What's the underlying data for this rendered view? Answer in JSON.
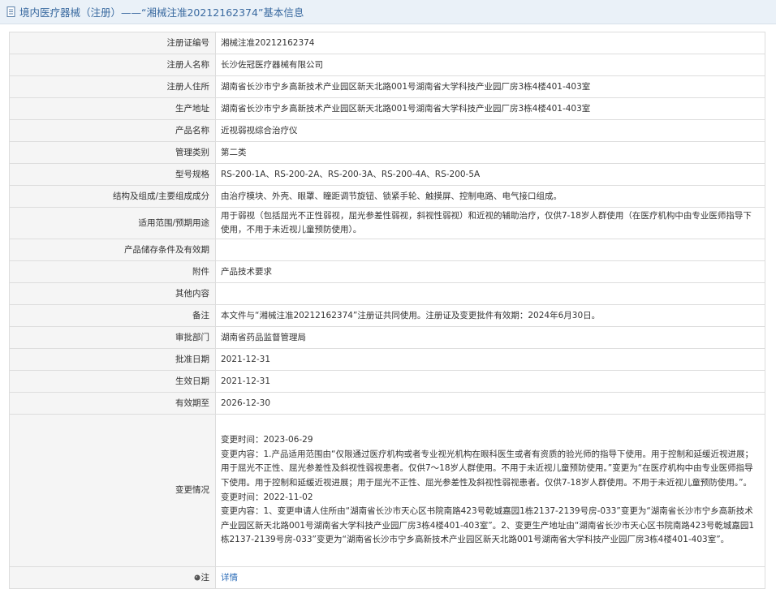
{
  "header": {
    "title": "境内医疗器械（注册）——“湘械注准20212162374”基本信息"
  },
  "rows": [
    {
      "label": "注册证编号",
      "value": "湘械注准20212162374"
    },
    {
      "label": "注册人名称",
      "value": "长沙佐冠医疗器械有限公司"
    },
    {
      "label": "注册人住所",
      "value": "湖南省长沙市宁乡高新技术产业园区新天北路001号湖南省大学科技产业园厂房3栋4楼401-403室"
    },
    {
      "label": "生产地址",
      "value": "湖南省长沙市宁乡高新技术产业园区新天北路001号湖南省大学科技产业园厂房3栋4楼401-403室"
    },
    {
      "label": "产品名称",
      "value": "近视弱视综合治疗仪"
    },
    {
      "label": "管理类别",
      "value": "第二类"
    },
    {
      "label": "型号规格",
      "value": "RS-200-1A、RS-200-2A、RS-200-3A、RS-200-4A、RS-200-5A"
    },
    {
      "label": "结构及组成/主要组成成分",
      "value": "由治疗模块、外壳、眼罩、瞳距调节旋钮、锁紧手轮、触摸屏、控制电路、电气接口组成。"
    },
    {
      "label": "适用范围/预期用途",
      "value": "用于弱视（包括屈光不正性弱视，屈光参差性弱视，斜视性弱视）和近视的辅助治疗，仅供7-18岁人群使用（在医疗机构中由专业医师指导下使用，不用于未近视儿童预防使用）。"
    },
    {
      "label": "产品储存条件及有效期",
      "value": ""
    },
    {
      "label": "附件",
      "value": "产品技术要求"
    },
    {
      "label": "其他内容",
      "value": ""
    },
    {
      "label": "备注",
      "value": "本文件与“湘械注准20212162374”注册证共同使用。注册证及变更批件有效期：2024年6月30日。"
    },
    {
      "label": "审批部门",
      "value": "湖南省药品监督管理局"
    },
    {
      "label": "批准日期",
      "value": "2021-12-31"
    },
    {
      "label": "生效日期",
      "value": "2021-12-31"
    },
    {
      "label": "有效期至",
      "value": "2026-12-30"
    }
  ],
  "changes": {
    "label": "变更情况",
    "lines": [
      "变更时间：2023-06-29",
      "变更内容：1.产品适用范围由“仅限通过医疗机构或者专业视光机构在眼科医生或者有资质的验光师的指导下使用。用于控制和延缓近视进展；用于屈光不正性、屈光参差性及斜视性弱视患者。仅供7～18岁人群使用。不用于未近视儿童预防使用。”变更为“在医疗机构中由专业医师指导下使用。用于控制和延缓近视进展；用于屈光不正性、屈光参差性及斜视性弱视患者。仅供7-18岁人群使用。不用于未近视儿童预防使用。”。",
      "变更时间：2022-11-02",
      "变更内容：1、变更申请人住所由“湖南省长沙市天心区书院南路423号乾城嘉园1栋2137-2139号房-033”变更为“湖南省长沙市宁乡高新技术产业园区新天北路001号湖南省大学科技产业园厂房3栋4楼401-403室”。2、变更生产地址由“湖南省长沙市天心区书院南路423号乾城嘉园1栋2137-2139号房-033”变更为“湖南省长沙市宁乡高新技术产业园区新天北路001号湖南省大学科技产业园厂房3栋4楼401-403室”。"
    ]
  },
  "note": {
    "label": "注",
    "link_text": "详情"
  }
}
